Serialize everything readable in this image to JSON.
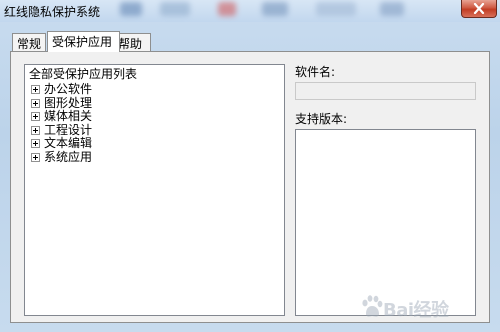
{
  "window": {
    "title": "红线隐私保护系统"
  },
  "tabs": [
    {
      "label": "常规",
      "active": false
    },
    {
      "label": "受保护应用",
      "active": true
    },
    {
      "label": "帮助",
      "active": false
    }
  ],
  "tree": {
    "root_label": "全部受保护应用列表",
    "items": [
      {
        "label": "办公软件",
        "icon": "expand-plus-icon"
      },
      {
        "label": "图形处理",
        "icon": "expand-plus-icon"
      },
      {
        "label": "媒体相关",
        "icon": "expand-plus-icon"
      },
      {
        "label": "工程设计",
        "icon": "expand-plus-icon"
      },
      {
        "label": "文本编辑",
        "icon": "expand-plus-icon"
      },
      {
        "label": "系统应用",
        "icon": "expand-plus-icon"
      }
    ]
  },
  "details": {
    "software_name_label": "软件名:",
    "software_name_value": "",
    "supported_versions_label": "支持版本:"
  },
  "watermark": {
    "text": "Bai经验",
    "icon": "baidu-paw-logo"
  },
  "colors": {
    "window_frame": "#c3d8ee",
    "close_button": "#c94a33",
    "panel_bg": "#f0f0f0"
  }
}
